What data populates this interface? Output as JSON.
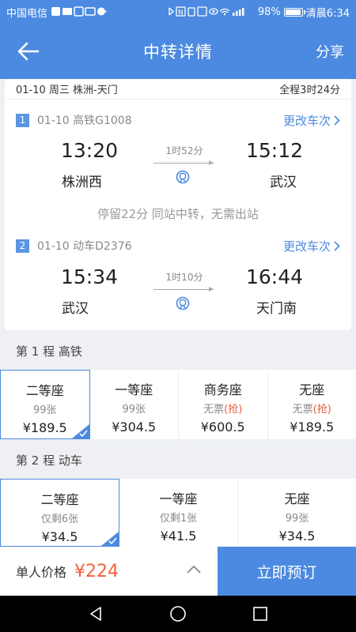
{
  "statusbar": {
    "carrier": "中国电信",
    "battery": "98%",
    "battery_level": 0.98,
    "time": "清晨6:34"
  },
  "header": {
    "title": "中转详情",
    "share": "分享"
  },
  "summary": {
    "date_route": "01-10 周三 株洲-天门",
    "total": "全程3时24分"
  },
  "legs": [
    {
      "num": "1",
      "info": "01-10 高铁G1008",
      "change": "更改车次",
      "dep_time": "13:20",
      "dep_station": "株洲西",
      "duration": "1时52分",
      "arr_time": "15:12",
      "arr_station": "武汉"
    },
    {
      "num": "2",
      "info": "01-10 动车D2376",
      "change": "更改车次",
      "dep_time": "15:34",
      "dep_station": "武汉",
      "duration": "1时10分",
      "arr_time": "16:44",
      "arr_station": "天门南"
    }
  ],
  "transfer_note": "停留22分 同站中转，无需出站",
  "segment1": {
    "label": "第 1 程  高铁",
    "seats": [
      {
        "name": "二等座",
        "count": "99张",
        "grab": "",
        "price": "¥189.5",
        "selected": true
      },
      {
        "name": "一等座",
        "count": "99张",
        "grab": "",
        "price": "¥304.5",
        "selected": false
      },
      {
        "name": "商务座",
        "count": "无票",
        "grab": "(抢)",
        "price": "¥600.5",
        "selected": false
      },
      {
        "name": "无座",
        "count": "无票",
        "grab": "(抢)",
        "price": "¥189.5",
        "selected": false
      }
    ]
  },
  "segment2": {
    "label": "第 2 程  动车",
    "seats": [
      {
        "name": "二等座",
        "count": "仅剩6张",
        "grab": "",
        "price": "¥34.5",
        "selected": true
      },
      {
        "name": "一等座",
        "count": "仅剩1张",
        "grab": "",
        "price": "¥41.5",
        "selected": false
      },
      {
        "name": "无座",
        "count": "99张",
        "grab": "",
        "price": "¥34.5",
        "selected": false
      }
    ]
  },
  "bottom": {
    "price_label": "单人价格",
    "price": "¥224",
    "book": "立即预订"
  },
  "colors": {
    "primary": "#4b8ae0",
    "price": "#f5613a",
    "grab": "#e45b3f"
  }
}
